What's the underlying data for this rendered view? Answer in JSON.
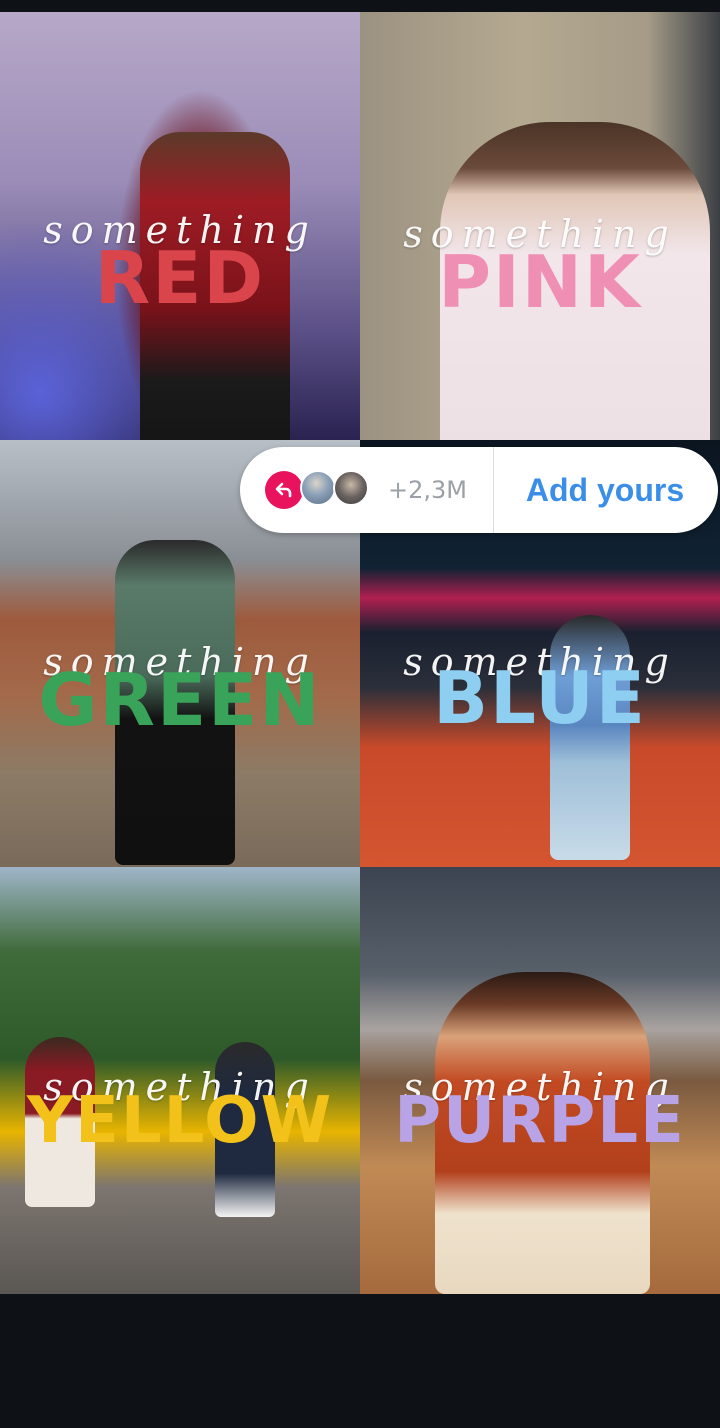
{
  "tiles": [
    {
      "script": "something",
      "word": "RED",
      "word_color": "#d9454a"
    },
    {
      "script": "something",
      "word": "PINK",
      "word_color": "#ef8fb4"
    },
    {
      "script": "something",
      "word": "GREEN",
      "word_color": "#3aa35a"
    },
    {
      "script": "something",
      "word": "BLUE",
      "word_color": "#8ecff1"
    },
    {
      "script": "something",
      "word": "YELLOW",
      "word_color": "#f2c21b"
    },
    {
      "script": "something",
      "word": "PURPLE",
      "word_color": "#b7a3e6"
    }
  ],
  "sticker": {
    "reply_icon": "reply-arrow-icon",
    "reply_color": "#e8125d",
    "count": "+2,3M",
    "add_label": "Add yours",
    "add_color": "#3a8ee8"
  }
}
